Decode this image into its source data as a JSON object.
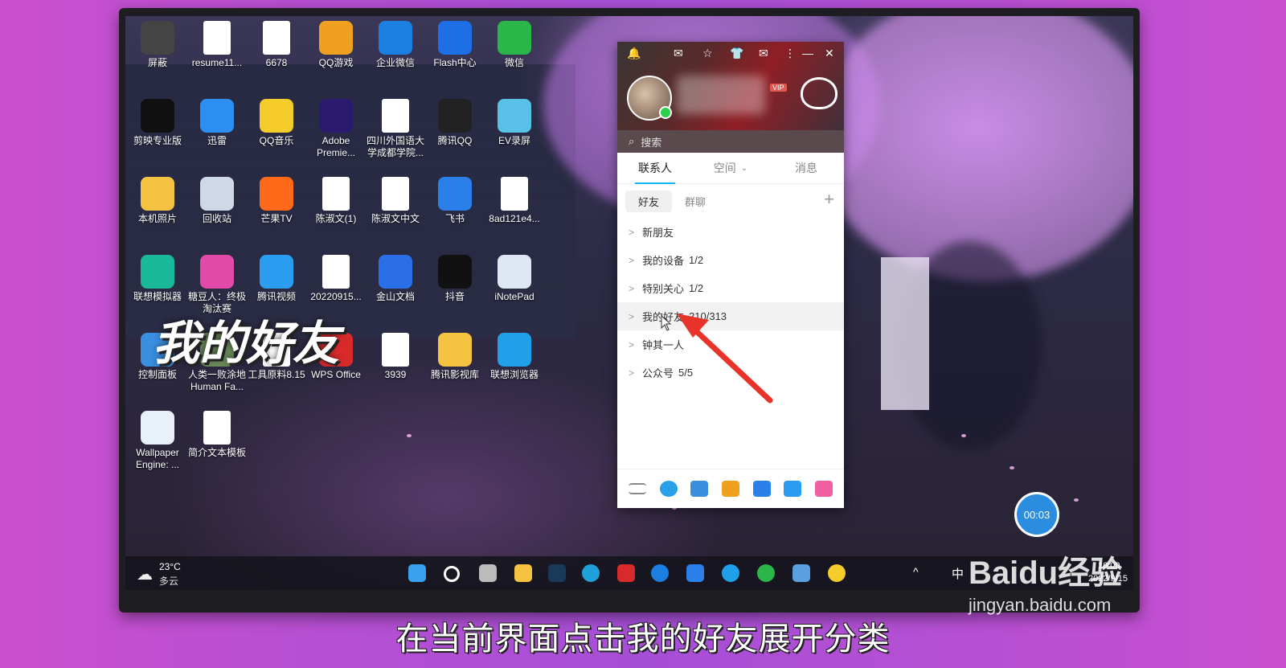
{
  "desktop": {
    "icons": [
      {
        "label": "屏蔽",
        "icon": "app-icon",
        "color": "#444"
      },
      {
        "label": "resume11...",
        "icon": "word-doc-icon",
        "color": "#fff"
      },
      {
        "label": "6678",
        "icon": "word-doc-icon",
        "color": "#fff"
      },
      {
        "label": "QQ游戏",
        "icon": "qq-game-icon",
        "color": "#f0a020"
      },
      {
        "label": "企业微信",
        "icon": "wecom-icon",
        "color": "#1a7fe0"
      },
      {
        "label": "Flash中心",
        "icon": "flash-icon",
        "color": "#1e6fe6"
      },
      {
        "label": "微信",
        "icon": "wechat-icon",
        "color": "#2bb64a"
      },
      {
        "label": "剪映专业版",
        "icon": "capcut-icon",
        "color": "#111"
      },
      {
        "label": "迅雷",
        "icon": "xunlei-icon",
        "color": "#2a8ff0"
      },
      {
        "label": "QQ音乐",
        "icon": "qq-music-icon",
        "color": "#f4cd2a"
      },
      {
        "label": "Adobe Premie...",
        "icon": "premiere-icon",
        "color": "#2a1a6e"
      },
      {
        "label": "四川外国语大学成都学院...",
        "icon": "word-doc-icon",
        "color": "#fff"
      },
      {
        "label": "腾讯QQ",
        "icon": "qq-icon",
        "color": "#222"
      },
      {
        "label": "EV录屏",
        "icon": "ev-recorder-icon",
        "color": "#59c0e8"
      },
      {
        "label": "本机照片",
        "icon": "folder-icon",
        "color": "#f5c242"
      },
      {
        "label": "回收站",
        "icon": "recycle-bin-icon",
        "color": "#cfd8e6"
      },
      {
        "label": "芒果TV",
        "icon": "mango-tv-icon",
        "color": "#ff6a1a"
      },
      {
        "label": "陈淑文(1)",
        "icon": "wps-sheet-icon",
        "color": "#fff"
      },
      {
        "label": "陈淑文中文",
        "icon": "word-doc-icon",
        "color": "#fff"
      },
      {
        "label": "飞书",
        "icon": "feishu-icon",
        "color": "#2a7fe8"
      },
      {
        "label": "8ad121e4...",
        "icon": "image-file-icon",
        "color": "#fff"
      },
      {
        "label": "联想模拟器",
        "icon": "emulator-icon",
        "color": "#19b89a"
      },
      {
        "label": "糖豆人：终极淘汰赛",
        "icon": "fall-guys-icon",
        "color": "#e24aa8"
      },
      {
        "label": "腾讯视频",
        "icon": "tencent-video-icon",
        "color": "#2a9df0"
      },
      {
        "label": "20220915...",
        "icon": "image-file-icon",
        "color": "#fff"
      },
      {
        "label": "金山文档",
        "icon": "kdocs-icon",
        "color": "#2a6fe8"
      },
      {
        "label": "抖音",
        "icon": "douyin-icon",
        "color": "#111"
      },
      {
        "label": "iNotePad",
        "icon": "notepad-icon",
        "color": "#dfe8f2"
      },
      {
        "label": "控制面板",
        "icon": "control-panel-icon",
        "color": "#3b8fe0"
      },
      {
        "label": "人类一败涂地 Human Fa...",
        "icon": "game-icon",
        "color": "#6a8a5a"
      },
      {
        "label": "工具原料8.15",
        "icon": "text-file-icon",
        "color": "#fff"
      },
      {
        "label": "WPS Office",
        "icon": "wps-icon",
        "color": "#d82a2a"
      },
      {
        "label": "3939",
        "icon": "word-doc-icon",
        "color": "#fff"
      },
      {
        "label": "腾讯影视库",
        "icon": "folder-icon",
        "color": "#f5c242"
      },
      {
        "label": "联想浏览器",
        "icon": "lenovo-browser-icon",
        "color": "#1fa0e8"
      },
      {
        "label": "Wallpaper Engine: ...",
        "icon": "wallpaper-engine-icon",
        "color": "#e8f0f8"
      },
      {
        "label": "简介文本模板",
        "icon": "text-file-icon",
        "color": "#fff"
      }
    ]
  },
  "overlay_caption": "我的好友",
  "qq": {
    "header": {
      "vip": "VIP"
    },
    "search_placeholder": "搜索",
    "tabs": [
      "联系人",
      "空间",
      "消息"
    ],
    "subtabs": [
      "好友",
      "群聊"
    ],
    "add_symbol": "+",
    "groups": [
      {
        "name": "新朋友",
        "count": ""
      },
      {
        "name": "我的设备",
        "count": "1/2"
      },
      {
        "name": "特别关心",
        "count": "1/2"
      },
      {
        "name": "我的好友",
        "count": "210/313"
      },
      {
        "name": "钟其一人",
        "count": ""
      },
      {
        "name": "公众号",
        "count": "5/5"
      }
    ]
  },
  "taskbar": {
    "weather_temp": "23°C",
    "weather_desc": "多云",
    "ime": "中",
    "time": "16:00",
    "date": "2022/9/15"
  },
  "timer": "00:03",
  "watermark": {
    "brand": "Baidu经验",
    "url": "jingyan.baidu.com"
  },
  "subtitle": "在当前界面点击我的好友展开分类",
  "colors": {
    "accent": "#12b7f5",
    "arrow": "#e8332a"
  }
}
